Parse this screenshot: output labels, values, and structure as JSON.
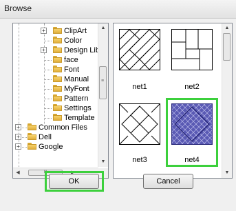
{
  "window": {
    "title": "Browse"
  },
  "tree": {
    "items": [
      {
        "label": "ClipArt",
        "expander": "+"
      },
      {
        "label": "Color",
        "expander": ""
      },
      {
        "label": "Design Lib",
        "expander": "+"
      },
      {
        "label": "face",
        "expander": ""
      },
      {
        "label": "Font",
        "expander": ""
      },
      {
        "label": "Manual",
        "expander": ""
      },
      {
        "label": "MyFont",
        "expander": ""
      },
      {
        "label": "Pattern",
        "expander": ""
      },
      {
        "label": "Settings",
        "expander": ""
      },
      {
        "label": "Template",
        "expander": ""
      },
      {
        "label": "Common Files",
        "expander": "+"
      },
      {
        "label": "Dell",
        "expander": "+"
      },
      {
        "label": "Google",
        "expander": "+"
      }
    ],
    "hscroll_grip": "III"
  },
  "thumbnails": [
    {
      "label": "net1",
      "selected": false
    },
    {
      "label": "net2",
      "selected": false
    },
    {
      "label": "net3",
      "selected": false
    },
    {
      "label": "net4",
      "selected": true
    }
  ],
  "buttons": {
    "ok_label": "OK",
    "cancel_label": "Cancel"
  },
  "colors": {
    "highlight": "#3cd03c",
    "selection": "#0a246a",
    "net4_fill": "#5a5ab4"
  }
}
